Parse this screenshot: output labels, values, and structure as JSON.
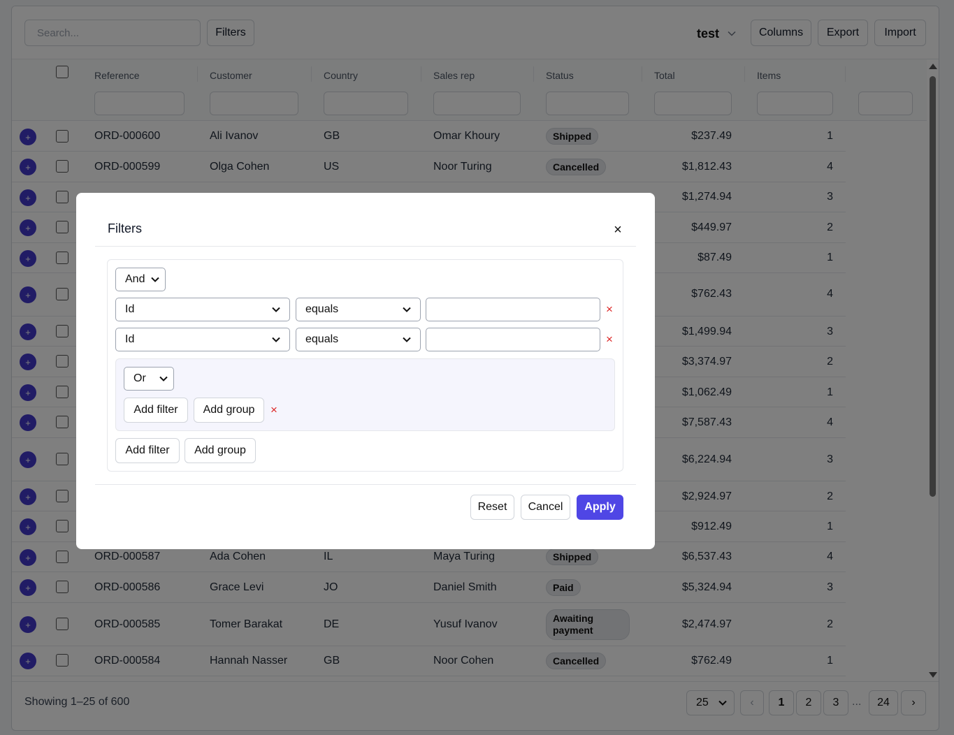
{
  "toolbar": {
    "search_placeholder": "Search...",
    "filters_label": "Filters",
    "view_name": "test",
    "columns_label": "Columns",
    "export_label": "Export",
    "import_label": "Import"
  },
  "table": {
    "columns": [
      "Reference",
      "Customer",
      "Country",
      "Sales rep",
      "Status",
      "Total",
      "Items"
    ],
    "rows": [
      {
        "ref": "ORD-000600",
        "customer": "Ali Ivanov",
        "country": "GB",
        "rep": "Omar Khoury",
        "status": "Shipped",
        "total": "$237.49",
        "items": "1"
      },
      {
        "ref": "ORD-000599",
        "customer": "Olga Cohen",
        "country": "US",
        "rep": "Noor Turing",
        "status": "Cancelled",
        "total": "$1,812.43",
        "items": "4"
      },
      {
        "ref": "",
        "customer": "",
        "country": "",
        "rep": "",
        "status": "",
        "total": "$1,274.94",
        "items": "3"
      },
      {
        "ref": "",
        "customer": "",
        "country": "",
        "rep": "",
        "status": "",
        "total": "$449.97",
        "items": "2"
      },
      {
        "ref": "",
        "customer": "",
        "country": "",
        "rep": "",
        "status": "",
        "total": "$87.49",
        "items": "1"
      },
      {
        "ref": "",
        "customer": "",
        "country": "",
        "rep": "",
        "status": "",
        "total": "$762.43",
        "items": "4"
      },
      {
        "ref": "",
        "customer": "",
        "country": "",
        "rep": "",
        "status": "",
        "total": "$1,499.94",
        "items": "3"
      },
      {
        "ref": "",
        "customer": "",
        "country": "",
        "rep": "",
        "status": "",
        "total": "$3,374.97",
        "items": "2"
      },
      {
        "ref": "",
        "customer": "",
        "country": "",
        "rep": "",
        "status": "",
        "total": "$1,062.49",
        "items": "1"
      },
      {
        "ref": "",
        "customer": "",
        "country": "",
        "rep": "",
        "status": "",
        "total": "$7,587.43",
        "items": "4"
      },
      {
        "ref": "",
        "customer": "",
        "country": "",
        "rep": "",
        "status": "",
        "total": "$6,224.94",
        "items": "3"
      },
      {
        "ref": "",
        "customer": "",
        "country": "",
        "rep": "",
        "status": "",
        "total": "$2,924.97",
        "items": "2"
      },
      {
        "ref": "",
        "customer": "",
        "country": "",
        "rep": "",
        "status": "",
        "total": "$912.49",
        "items": "1"
      },
      {
        "ref": "ORD-000587",
        "customer": "Ada Cohen",
        "country": "IL",
        "rep": "Maya Turing",
        "status": "Shipped",
        "total": "$6,537.43",
        "items": "4"
      },
      {
        "ref": "ORD-000586",
        "customer": "Grace Levi",
        "country": "JO",
        "rep": "Daniel Smith",
        "status": "Paid",
        "total": "$5,324.94",
        "items": "3"
      },
      {
        "ref": "ORD-000585",
        "customer": "Tomer Barakat",
        "country": "DE",
        "rep": "Yusuf Ivanov",
        "status": "Awaiting payment",
        "total": "$2,474.97",
        "items": "2"
      },
      {
        "ref": "ORD-000584",
        "customer": "Hannah Nasser",
        "country": "GB",
        "rep": "Noor Cohen",
        "status": "Cancelled",
        "total": "$762.49",
        "items": "1"
      }
    ]
  },
  "footer": {
    "showing_text": "Showing 1–25 of 600",
    "page_size": "25",
    "pages": [
      "1",
      "2",
      "3",
      "24"
    ],
    "ellipsis": "...",
    "prev": "‹",
    "next": "›"
  },
  "modal": {
    "title": "Filters",
    "close": "×",
    "root_operator": "And",
    "conditions": [
      {
        "field": "Id",
        "operator": "equals",
        "value": ""
      },
      {
        "field": "Id",
        "operator": "equals",
        "value": ""
      }
    ],
    "subgroup": {
      "operator": "Or",
      "add_filter_label": "Add filter",
      "add_group_label": "Add group"
    },
    "add_filter_label": "Add filter",
    "add_group_label": "Add group",
    "remove_glyph": "×",
    "reset_label": "Reset",
    "cancel_label": "Cancel",
    "apply_label": "Apply"
  },
  "colors": {
    "accent": "#4f46e5",
    "expand_button": "#4338ca",
    "remove": "#dc2626"
  }
}
